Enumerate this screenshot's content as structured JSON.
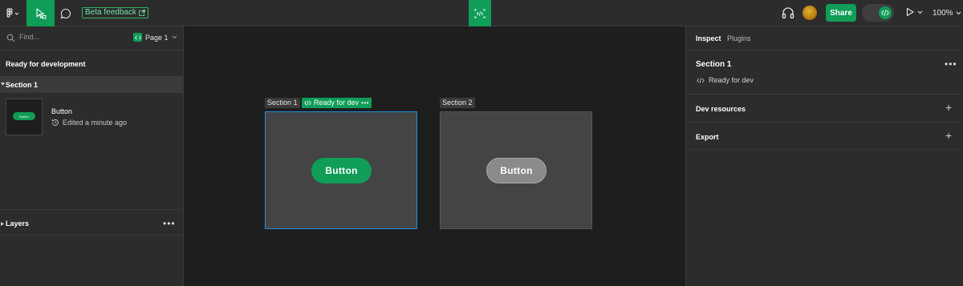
{
  "toolbar": {
    "beta_feedback": "Beta feedback",
    "share": "Share",
    "zoom": "100%"
  },
  "left_panel": {
    "search_placeholder": "Find...",
    "page": "Page 1",
    "ready_heading": "Ready for development",
    "section": "Section 1",
    "component": {
      "name": "Button",
      "thumbnail_label": "Button",
      "edited": "Edited a minute ago"
    },
    "layers": "Layers"
  },
  "canvas": {
    "section1_label": "Section 1",
    "ready_tag": "Ready for dev",
    "section1_button": "Button",
    "section2_label": "Section 2",
    "section2_button": "Button"
  },
  "right_panel": {
    "tabs": [
      "Inspect",
      "Plugins"
    ],
    "section_title": "Section 1",
    "status": "Ready for dev",
    "dev_resources": "Dev resources",
    "export": "Export"
  },
  "colors": {
    "accent": "#0f9d58",
    "selection": "#1f8fe0",
    "panel": "#2c2c2c",
    "canvas": "#1e1e1e"
  }
}
